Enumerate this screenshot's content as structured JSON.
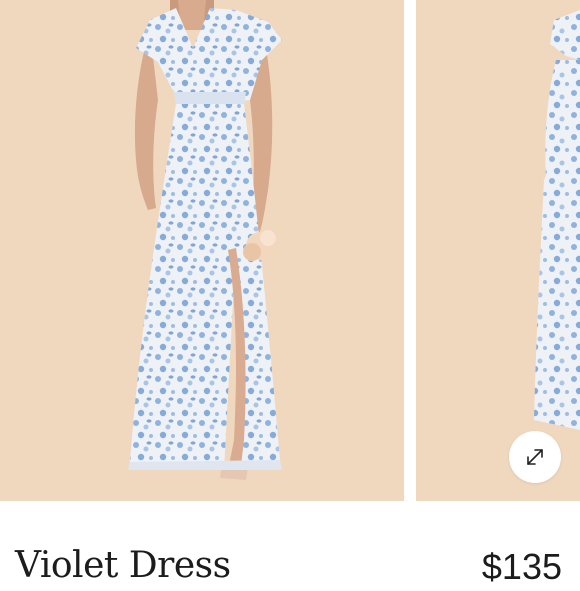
{
  "product": {
    "name": "Violet Dress",
    "price": "$135"
  },
  "gallery": {
    "images": [
      {
        "alt": "Violet Dress front view",
        "icon": "dress-photo"
      },
      {
        "alt": "Violet Dress alternate view",
        "icon": "dress-photo"
      }
    ],
    "expand_icon": "expand-arrows-icon"
  },
  "colors": {
    "backdrop": "#f0d8bf",
    "dress_base": "#eef1f6",
    "dress_print": "#8fb3df",
    "text": "#1c1c1c"
  }
}
